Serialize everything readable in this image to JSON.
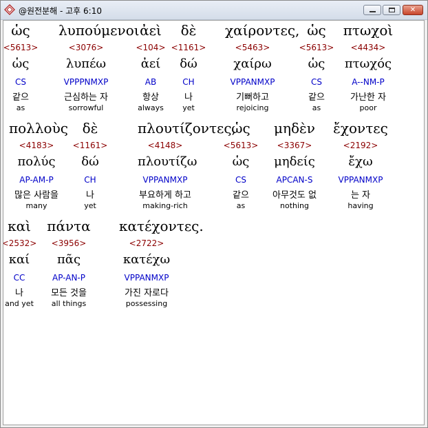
{
  "window": {
    "title": "@원전분해 - 고후 6:10",
    "app_icon": "bible-app-icon",
    "controls": {
      "minimize": "minimize-icon",
      "maximize": "maximize-icon",
      "close_label": "✕"
    }
  },
  "rows": [
    {
      "words": [
        {
          "greek": "ὡς",
          "strong": "<5613>",
          "lemma": "ὡς",
          "morph": "CS",
          "korean": "같으",
          "english": "as"
        },
        {
          "greek": "λυπούμενοι",
          "strong": "<3076>",
          "lemma": "λυπέω",
          "morph": "VPPPNMXP",
          "korean": "근심하는 자",
          "english": "sorrowful"
        },
        {
          "greek": "ἀεὶ",
          "strong": "<104>",
          "lemma": "ἀεί",
          "morph": "AB",
          "korean": "항상",
          "english": "always"
        },
        {
          "greek": "δὲ",
          "strong": "<1161>",
          "lemma": "δώ",
          "morph": "CH",
          "korean": "나",
          "english": "yet"
        },
        {
          "greek": "χαίροντες,",
          "strong": "<5463>",
          "lemma": "χαίρω",
          "morph": "VPPANMXP",
          "korean": "기뻐하고",
          "english": "rejoicing"
        },
        {
          "greek": "ὡς",
          "strong": "<5613>",
          "lemma": "ὡς",
          "morph": "CS",
          "korean": "같으",
          "english": "as"
        },
        {
          "greek": "πτωχοὶ",
          "strong": "<4434>",
          "lemma": "πτωχός",
          "morph": "A--NM-P",
          "korean": "가난한 자",
          "english": "poor"
        }
      ]
    },
    {
      "words": [
        {
          "greek": "πολλοὺς",
          "strong": "<4183>",
          "lemma": "πολύς",
          "morph": "AP-AM-P",
          "korean": "많은 사람을",
          "english": "many"
        },
        {
          "greek": "δὲ",
          "strong": "<1161>",
          "lemma": "δώ",
          "morph": "CH",
          "korean": "나",
          "english": "yet"
        },
        {
          "greek": "πλουτίζοντες,",
          "strong": "<4148>",
          "lemma": "πλουτίζω",
          "morph": "VPPANMXP",
          "korean": "부요하게 하고",
          "english": "making-rich"
        },
        {
          "greek": "ὡς",
          "strong": "<5613>",
          "lemma": "ὡς",
          "morph": "CS",
          "korean": "같으",
          "english": "as"
        },
        {
          "greek": "μηδὲν",
          "strong": "<3367>",
          "lemma": "μηδείς",
          "morph": "APCAN-S",
          "korean": "아무것도 없",
          "english": "nothing"
        },
        {
          "greek": "ἔχοντες",
          "strong": "<2192>",
          "lemma": "ἔχω",
          "morph": "VPPANMXP",
          "korean": "는 자",
          "english": "having"
        }
      ]
    },
    {
      "words": [
        {
          "greek": "καὶ",
          "strong": "<2532>",
          "lemma": "καί",
          "morph": "CC",
          "korean": "나",
          "english": "and yet"
        },
        {
          "greek": "πάντα",
          "strong": "<3956>",
          "lemma": "πᾶς",
          "morph": "AP-AN-P",
          "korean": "모든 것을",
          "english": "all things"
        },
        {
          "greek": "κατέχοντες.",
          "strong": "<2722>",
          "lemma": "κατέχω",
          "morph": "VPPANMXP",
          "korean": "가진 자로다",
          "english": "possessing"
        }
      ]
    }
  ]
}
